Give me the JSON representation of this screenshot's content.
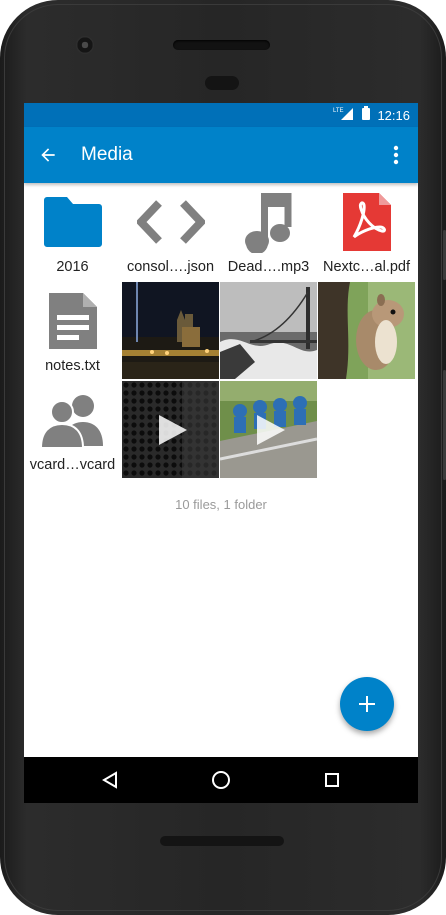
{
  "status_bar": {
    "network": "LTE",
    "time": "12:16"
  },
  "app_bar": {
    "title": "Media",
    "back_icon": "arrow-back-icon",
    "menu_icon": "more-vert-icon"
  },
  "items": [
    {
      "type": "folder",
      "label": "2016",
      "icon": "folder-icon"
    },
    {
      "type": "file",
      "label": "consol….json",
      "icon": "code-icon"
    },
    {
      "type": "file",
      "label": "Dead….mp3",
      "icon": "music-note-icon"
    },
    {
      "type": "file",
      "label": "Nextc…al.pdf",
      "icon": "pdf-icon"
    },
    {
      "type": "file",
      "label": "notes.txt",
      "icon": "text-document-icon"
    },
    {
      "type": "image",
      "icon": "photo-thumbnail-night-city"
    },
    {
      "type": "image",
      "icon": "photo-thumbnail-bridge"
    },
    {
      "type": "image",
      "icon": "photo-thumbnail-squirrel"
    },
    {
      "type": "file",
      "label": "vcard…vcard",
      "icon": "contacts-icon"
    },
    {
      "type": "video",
      "icon": "video-thumbnail-dark"
    },
    {
      "type": "video",
      "icon": "video-thumbnail-cyclists"
    }
  ],
  "footer": {
    "count_text": "10 files, 1 folder"
  },
  "fab": {
    "icon": "plus-icon"
  },
  "navigation": {
    "icons": [
      "back-triangle-icon",
      "home-circle-icon",
      "recents-square-icon"
    ]
  },
  "colors": {
    "primary": "#0082c9",
    "status_bar": "#0070b8",
    "folder": "#0082c9",
    "pdf": "#e53935",
    "file_icon_gray": "#808080"
  }
}
